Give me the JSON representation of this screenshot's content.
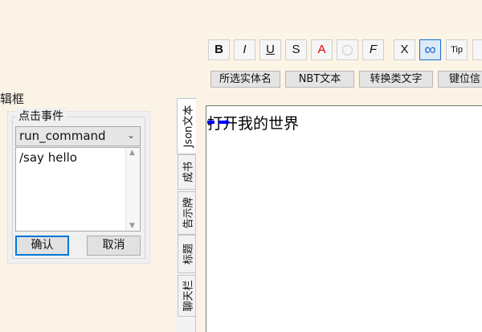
{
  "dialog": {
    "title_fragment": "辑框",
    "group_legend": "点击事件",
    "command_select": {
      "value": "run_command"
    },
    "command_textarea": {
      "value": "/say hello"
    },
    "confirm_label": "确认",
    "cancel_label": "取消"
  },
  "toolbar": {
    "format_buttons": [
      {
        "label": "B",
        "icon": "bold-icon"
      },
      {
        "label": "I",
        "icon": "italic-icon"
      },
      {
        "label": "U",
        "icon": "underline-icon"
      },
      {
        "label": "S",
        "icon": "strikethrough-icon"
      },
      {
        "label": "A",
        "icon": "color-icon",
        "color": "#e00000"
      },
      {
        "label": "",
        "icon": "circle-icon"
      },
      {
        "label": "F",
        "icon": "font-icon"
      },
      {
        "label": "X",
        "icon": "clear-icon"
      },
      {
        "label": "∞",
        "icon": "link-icon",
        "color": "#1a6fd0"
      },
      {
        "label": "Tip",
        "icon": "tip-icon"
      }
    ],
    "tabs": [
      {
        "label": "所选实体名"
      },
      {
        "label": "NBT文本"
      },
      {
        "label": "转换类文字"
      },
      {
        "label": "键位信"
      }
    ]
  },
  "side_tabs": [
    {
      "label": "Json文本",
      "active": true
    },
    {
      "label": "成书",
      "active": false
    },
    {
      "label": "告示牌",
      "active": false
    },
    {
      "label": "标题",
      "active": false
    },
    {
      "label": "聊天栏",
      "active": false
    }
  ],
  "editor": {
    "text": "打开我的世界"
  },
  "colors": {
    "background": "#fbf3e6",
    "accent": "#0078d7",
    "marker": "#0000ff"
  }
}
